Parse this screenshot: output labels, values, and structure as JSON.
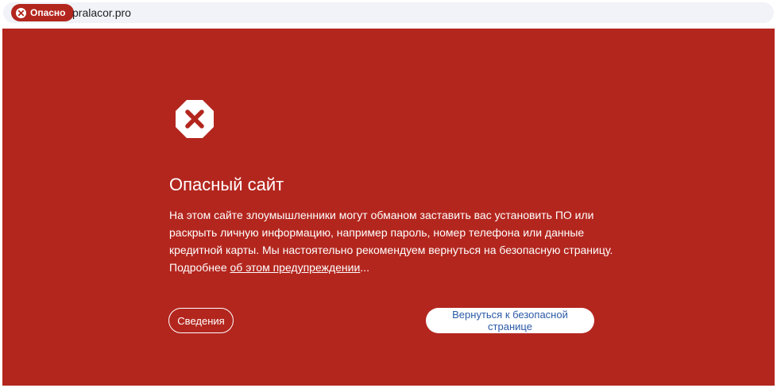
{
  "addressbar": {
    "badge_label": "Опасно",
    "url": "pralacor.pro"
  },
  "warning": {
    "icon": "danger-octagon-x-icon",
    "title": "Опасный сайт",
    "description": "На этом сайте злоумышленники могут обманом заставить вас установить ПО или раскрыть личную информацию, например пароль, номер телефона или данные кредитной карты. Мы настоятельно рекомендуем вернуться на безопасную страницу.",
    "more_prefix": "Подробнее",
    "more_link": "об этом предупреждении",
    "more_suffix": "..."
  },
  "buttons": {
    "details_label": "Сведения",
    "back_label": "Вернуться к безопасной странице"
  },
  "colors": {
    "danger_red": "#b3261e",
    "link_blue": "#2b5aa6"
  }
}
